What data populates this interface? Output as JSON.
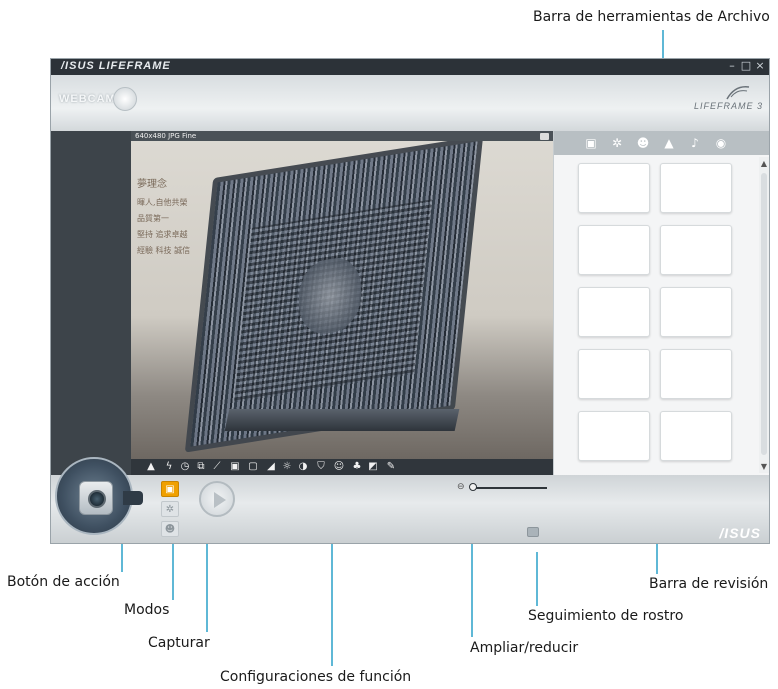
{
  "callouts": {
    "file_toolbar": "Barra de herramientas de Archivo",
    "action_button": "Botón de acción",
    "modes": "Modos",
    "capture": "Capturar",
    "function_settings": "Configuraciones de función",
    "zoom": "Ampliar/reducir",
    "face_tracking": "Seguimiento de rostro",
    "review_bar": "Barra de revisión"
  },
  "window": {
    "brand": "/ISUS LIFEFRAME",
    "minimize": "–",
    "maximize": "□",
    "close": "×",
    "webcam_label": "WEBCAM",
    "lifeframe_logo": "LIFEFRAME 3",
    "resolution": "640x480 JPG Fine",
    "asus_logo": "/ISUS"
  },
  "photo": {
    "wall_text": [
      "夢理念",
      "暉人,自他共榮",
      "品質第一",
      "堅持 追求卓越",
      "經驗 科技 誠信"
    ]
  },
  "file_toolbar_icons": [
    "camera-icon",
    "gear-icon",
    "face-icon",
    "video-icon",
    "microphone-icon",
    "eye-icon"
  ],
  "function_icons": [
    "person-icon",
    "flash-icon",
    "timer-icon",
    "burst-icon",
    "ruler-icon",
    "frame-icon",
    "border-icon",
    "signal-icon",
    "brightness-icon",
    "contrast-icon",
    "shield-icon",
    "face-effect-icon",
    "color-icon",
    "picture-icon",
    "wrench-icon"
  ],
  "review_thumbnails": 10,
  "colors": {
    "accent_callout": "#5fb8d6",
    "active_mode": "#f0a000"
  }
}
